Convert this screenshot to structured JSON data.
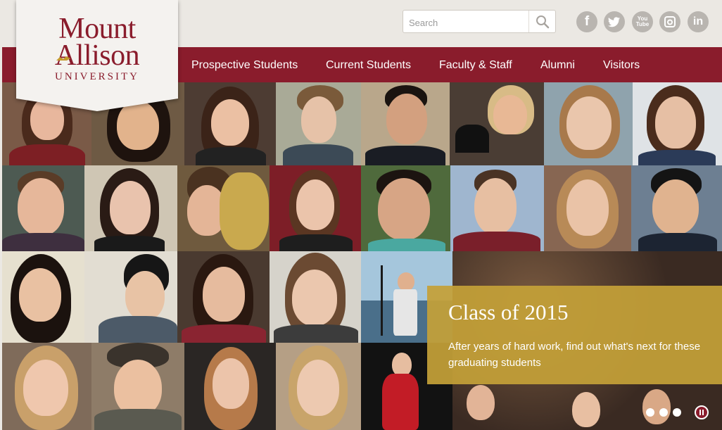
{
  "brand": {
    "line1": "Mount",
    "line2": "Allison",
    "line3": "UNIVERSITY",
    "color": "#8a1c2c"
  },
  "search": {
    "placeholder": "Search",
    "value": ""
  },
  "social": [
    {
      "name": "facebook-icon",
      "glyph": "f"
    },
    {
      "name": "twitter-icon",
      "glyph": "t"
    },
    {
      "name": "youtube-icon",
      "glyph": "You\nTube"
    },
    {
      "name": "instagram-icon",
      "glyph": "◎"
    },
    {
      "name": "linkedin-icon",
      "glyph": "in"
    }
  ],
  "nav": {
    "items": [
      {
        "label": "Prospective Students"
      },
      {
        "label": "Current Students"
      },
      {
        "label": "Faculty & Staff"
      },
      {
        "label": "Alumni"
      },
      {
        "label": "Visitors"
      }
    ]
  },
  "feature": {
    "title": "Class of 2015",
    "text": "After years of hard work, find out what's next for these graduating students",
    "accent": "#c4a038"
  },
  "slider": {
    "slides": 3,
    "active": 1
  }
}
